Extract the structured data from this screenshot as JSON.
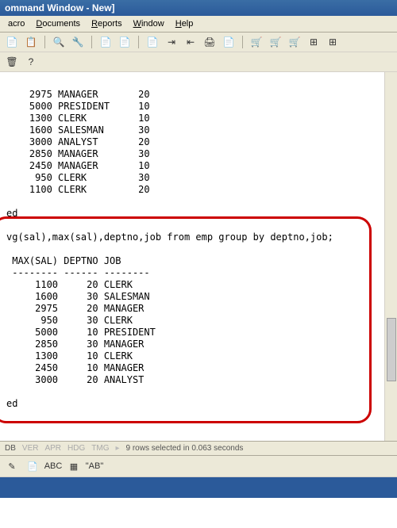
{
  "titlebar": {
    "text": "ommand Window - New]"
  },
  "menu": {
    "items": [
      {
        "label": "acro"
      },
      {
        "label": "Documents"
      },
      {
        "label": "Reports"
      },
      {
        "label": "Window"
      },
      {
        "label": "Help"
      }
    ]
  },
  "toolbar1": {
    "icons": [
      "📄",
      "📋",
      "⠀",
      "🔍",
      "🔧",
      "⠀",
      "📄",
      "📄",
      "⠀",
      "📄",
      "⇥",
      "⇤",
      "🖨",
      "📄",
      "⠀",
      "🛒",
      "🛒",
      "🛒",
      "⊞",
      "⊞"
    ]
  },
  "toolbar2": {
    "icons": [
      "🗑",
      "?"
    ]
  },
  "data_block1": {
    "rows": [
      {
        "c1": "2975",
        "c2": "MANAGER",
        "c3": "20"
      },
      {
        "c1": "5000",
        "c2": "PRESIDENT",
        "c3": "10"
      },
      {
        "c1": "1300",
        "c2": "CLERK",
        "c3": "10"
      },
      {
        "c1": "1600",
        "c2": "SALESMAN",
        "c3": "30"
      },
      {
        "c1": "3000",
        "c2": "ANALYST",
        "c3": "20"
      },
      {
        "c1": "2850",
        "c2": "MANAGER",
        "c3": "30"
      },
      {
        "c1": "2450",
        "c2": "MANAGER",
        "c3": "10"
      },
      {
        "c1": "950",
        "c2": "CLERK",
        "c3": "30"
      },
      {
        "c1": "1100",
        "c2": "CLERK",
        "c3": "20"
      }
    ],
    "footer": "ed"
  },
  "query": {
    "text": "vg(sal),max(sal),deptno,job from emp group by deptno,job;"
  },
  "data_block2": {
    "header": {
      "c1": "MAX(SAL)",
      "c2": "DEPTNO",
      "c3": "JOB"
    },
    "rows": [
      {
        "c1": "1100",
        "c2": "20",
        "c3": "CLERK"
      },
      {
        "c1": "1600",
        "c2": "30",
        "c3": "SALESMAN"
      },
      {
        "c1": "2975",
        "c2": "20",
        "c3": "MANAGER"
      },
      {
        "c1": "950",
        "c2": "30",
        "c3": "CLERK"
      },
      {
        "c1": "5000",
        "c2": "10",
        "c3": "PRESIDENT"
      },
      {
        "c1": "2850",
        "c2": "30",
        "c3": "MANAGER"
      },
      {
        "c1": "1300",
        "c2": "10",
        "c3": "CLERK"
      },
      {
        "c1": "2450",
        "c2": "10",
        "c3": "MANAGER"
      },
      {
        "c1": "3000",
        "c2": "20",
        "c3": "ANALYST"
      }
    ],
    "footer": "ed"
  },
  "status": {
    "items": [
      "DB",
      "VER",
      "APR",
      "HDG",
      "TMG"
    ],
    "arrow": "▸",
    "message": "9 rows selected in 0.063 seconds"
  },
  "sec_toolbar": {
    "items": [
      "✎",
      "📄",
      "ABC",
      "▦",
      "\"AB\""
    ]
  }
}
